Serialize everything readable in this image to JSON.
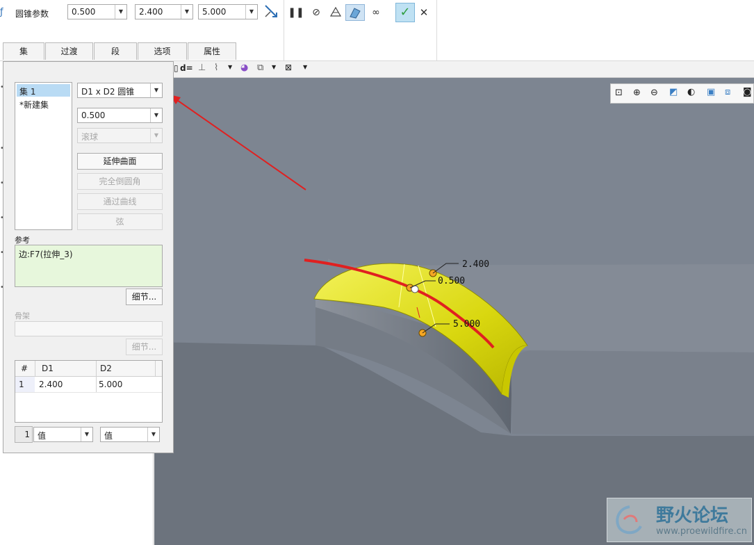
{
  "toolbar": {
    "label": "圆锥参数",
    "param1": "0.500",
    "param2": "2.400",
    "param3": "5.000"
  },
  "tabs": [
    {
      "label": "集"
    },
    {
      "label": "过渡"
    },
    {
      "label": "段"
    },
    {
      "label": "选项"
    },
    {
      "label": "属性"
    }
  ],
  "panel": {
    "sets": [
      "集 1",
      "*新建集"
    ],
    "shape_type": "D1 x D2 圆锥",
    "conic_value": "0.500",
    "roll_type": "滚球",
    "btn_extend": "延伸曲面",
    "btn_full_round": "完全倒圆角",
    "btn_through_curve": "通过曲线",
    "btn_chord": "弦",
    "ref_label": "参考",
    "ref_value": "边:F7(拉伸_3)",
    "details_btn": "细节...",
    "skeleton_label": "骨架",
    "skeleton_details_btn": "细节...",
    "table": {
      "headers": [
        "#",
        "D1",
        "D2"
      ],
      "rows": [
        [
          "1",
          "2.400",
          "5.000"
        ]
      ]
    },
    "bottom_index": "1",
    "bottom_value1": "值",
    "bottom_value2": "值"
  },
  "viewport": {
    "dims": [
      "2.400",
      "0.500",
      "5.000"
    ]
  },
  "subbar": {
    "dim_label": "d="
  },
  "watermark": {
    "title": "野火论坛",
    "url": "www.proewildfire.cn"
  },
  "colors": {
    "surface": "#e8e61c",
    "annotation": "#e02020",
    "viewport": "#7d8591",
    "accept": "#2e9e3e"
  }
}
